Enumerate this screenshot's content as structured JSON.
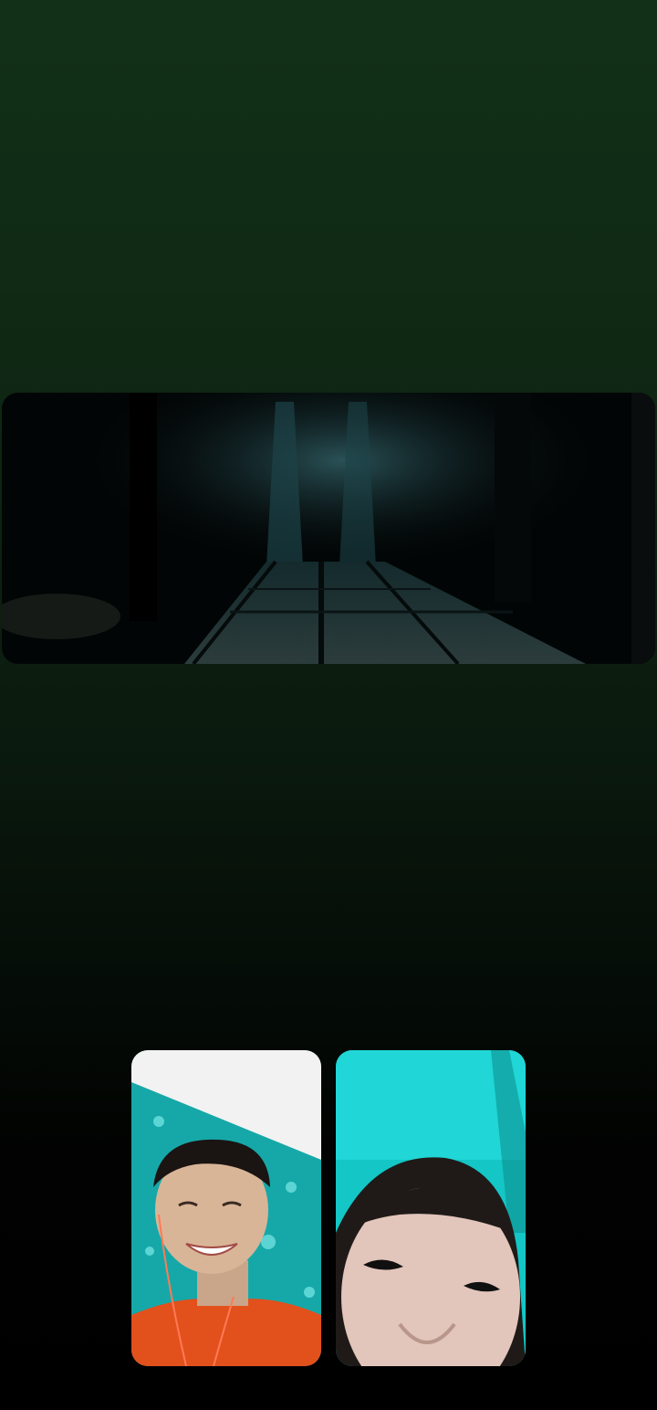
{
  "call": {
    "shared_screen": {
      "content": "dark-corridor-video"
    },
    "participants": [
      {
        "tile": "participant-1",
        "description_icon": "video-feed"
      },
      {
        "tile": "participant-2",
        "description_icon": "video-feed"
      }
    ]
  },
  "colors": {
    "background_top": "#123018",
    "background_bottom": "#000000",
    "teal": "#14c6c6",
    "orange": "#e2501c"
  }
}
